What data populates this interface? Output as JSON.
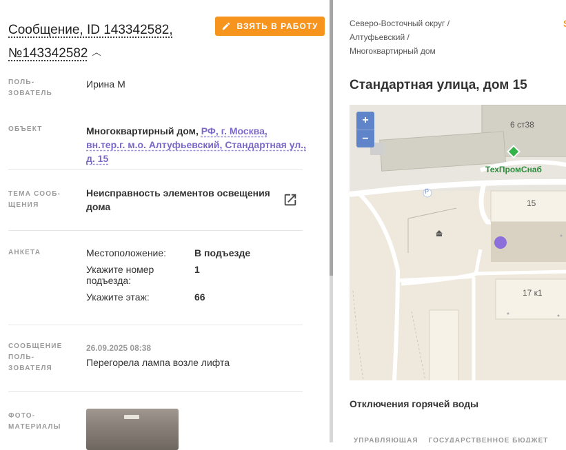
{
  "header": {
    "title_line1": "Сообщение, ID 143342582,",
    "title_line2": "№143342582",
    "take_button": "ВЗЯТЬ В РАБОТУ"
  },
  "fields": {
    "user_label_1": "ПОЛЬ-",
    "user_label_2": "ЗОВАТЕЛЬ",
    "user_value": "Ирина М",
    "object_label": "ОБЪЕКТ",
    "object_type": "Многоквартирный дом,",
    "object_address": "РФ, г. Москва, вн.тер.г. м.о. Алтуфьевский, Стандартная ул., д. 15",
    "topic_label_1": "ТЕМА СООБ-",
    "topic_label_2": "ЩЕНИЯ",
    "topic_value": "Неисправность элементов освещения дома",
    "form_label": "АНКЕТА",
    "form_rows": [
      {
        "q": "Местоположение:",
        "a": "В подъезде"
      },
      {
        "q": "Укажите номер подъезда:",
        "a": "1"
      },
      {
        "q": "Укажите этаж:",
        "a": "66"
      }
    ],
    "message_label_1": "СООБЩЕНИЕ",
    "message_label_2": "ПОЛЬ-",
    "message_label_3": "ЗОВАТЕЛЯ",
    "message_date": "26.09.2025 08:38",
    "message_text": "Перегорела лампа возле лифта",
    "photo_label_1": "ФОТО-",
    "photo_label_2": "МАТЕРИАЛЫ"
  },
  "right": {
    "crumb1": "Северо-Восточный округ /",
    "crumb2": "Алтуфьевский /",
    "crumb3": "Многоквартирный дом",
    "address": "Стандартная улица, дом 15",
    "map": {
      "zoom_in": "+",
      "zoom_out": "−",
      "building_6": "6 ст38",
      "poi": "ТехПромСнаб",
      "parking": "P",
      "building_15": "15",
      "building_17": "17 к1"
    },
    "hot_water": "Отключения горячей воды",
    "bottom_label": "УПРАВЛЯЮЩАЯ",
    "bottom_value": "ГОСУДАРСТВЕННОЕ БЮДЖЕТ"
  },
  "colors": {
    "accent": "#f7941d",
    "link": "#7b68c8",
    "map_zoom": "#5f84c9"
  }
}
